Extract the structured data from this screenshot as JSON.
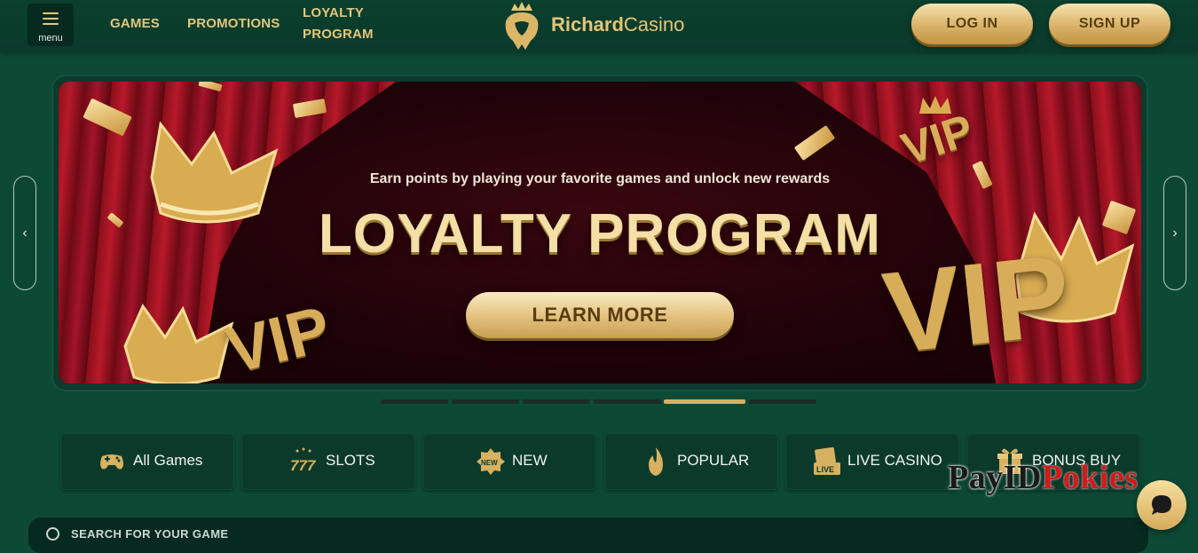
{
  "header": {
    "menu_label": "menu",
    "nav": [
      "GAMES",
      "PROMOTIONS",
      "LOYALTY",
      "PROGRAM"
    ],
    "logo_bold": "Richard",
    "logo_light": "Casino",
    "login_label": "LOG IN",
    "signup_label": "SIGN UP"
  },
  "banner": {
    "subtitle": "Earn points by playing your favorite games and unlock new rewards",
    "title": "LOYALTY PROGRAM",
    "cta_label": "LEARN MORE",
    "vip_text": "VIP",
    "slides_total": 6,
    "active_slide": 5
  },
  "categories": [
    {
      "label": "All Games",
      "icon": "gamepad-icon"
    },
    {
      "label": "SLOTS",
      "icon": "slot-777-icon"
    },
    {
      "label": "NEW",
      "icon": "new-badge-icon"
    },
    {
      "label": "POPULAR",
      "icon": "flame-icon"
    },
    {
      "label": "LIVE CASINO",
      "icon": "live-cards-icon"
    },
    {
      "label": "BONUS BUY",
      "icon": "gift-icon"
    }
  ],
  "search": {
    "placeholder": "SEARCH FOR YOUR GAME"
  },
  "watermark": {
    "part1": "PayID",
    "part2": "Pokies"
  },
  "colors": {
    "bg": "#0d4a36",
    "gold": "#d7b160",
    "header": "#0a3a2b"
  }
}
